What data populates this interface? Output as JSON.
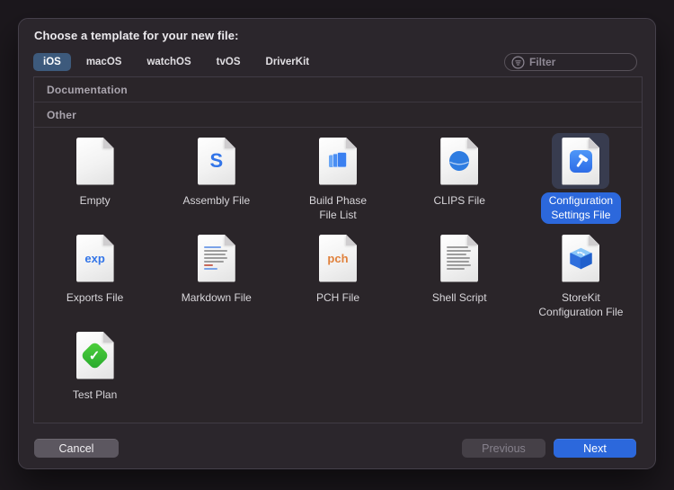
{
  "colors": {
    "accent": "#2c68dc",
    "selected_tab": "#3d5a7c",
    "selection_halo": "rgba(93,122,178,0.28)",
    "assembly_blue": "#3375e8",
    "pch_orange": "#e0813c",
    "test_green": "#35b832"
  },
  "dialog": {
    "title": "Choose a template for your new file:",
    "tabs": [
      {
        "label": "iOS",
        "selected": true
      },
      {
        "label": "macOS",
        "selected": false
      },
      {
        "label": "watchOS",
        "selected": false
      },
      {
        "label": "tvOS",
        "selected": false
      },
      {
        "label": "DriverKit",
        "selected": false
      }
    ],
    "filter": {
      "placeholder": "Filter",
      "icon": "filter-icon"
    },
    "sections": [
      {
        "label": "Documentation"
      },
      {
        "label": "Other"
      }
    ],
    "templates": [
      {
        "label": "Empty",
        "icon": "blank-document-icon",
        "kind": "blank",
        "selected": false
      },
      {
        "label": "Assembly File",
        "icon": "assembly-file-icon",
        "kind": "letter",
        "glyph": "S",
        "glyph_color": "#3375e8",
        "glyph_size": 22,
        "selected": false
      },
      {
        "label": "Build Phase\nFile List",
        "icon": "build-phase-file-list-icon",
        "kind": "pages",
        "selected": false
      },
      {
        "label": "CLIPS File",
        "icon": "clips-file-icon",
        "kind": "sphere",
        "selected": false
      },
      {
        "label": "Configuration\nSettings File",
        "icon": "configuration-settings-file-icon",
        "kind": "hammer",
        "selected": true
      },
      {
        "label": "Exports File",
        "icon": "exports-file-icon",
        "kind": "letter",
        "glyph": "exp",
        "glyph_color": "#3375e8",
        "glyph_size": 13,
        "selected": false
      },
      {
        "label": "Markdown File",
        "icon": "markdown-file-icon",
        "kind": "mdlines",
        "selected": false
      },
      {
        "label": "PCH File",
        "icon": "pch-file-icon",
        "kind": "letter",
        "glyph": "pch",
        "glyph_color": "#e0813c",
        "glyph_size": 13,
        "selected": false
      },
      {
        "label": "Shell Script",
        "icon": "shell-script-icon",
        "kind": "textlines",
        "selected": false
      },
      {
        "label": "StoreKit\nConfiguration File",
        "icon": "storekit-configuration-file-icon",
        "kind": "cube",
        "selected": false
      },
      {
        "label": "Test Plan",
        "icon": "test-plan-icon",
        "kind": "check",
        "selected": false
      }
    ],
    "buttons": {
      "cancel": "Cancel",
      "previous": "Previous",
      "next": "Next"
    }
  }
}
